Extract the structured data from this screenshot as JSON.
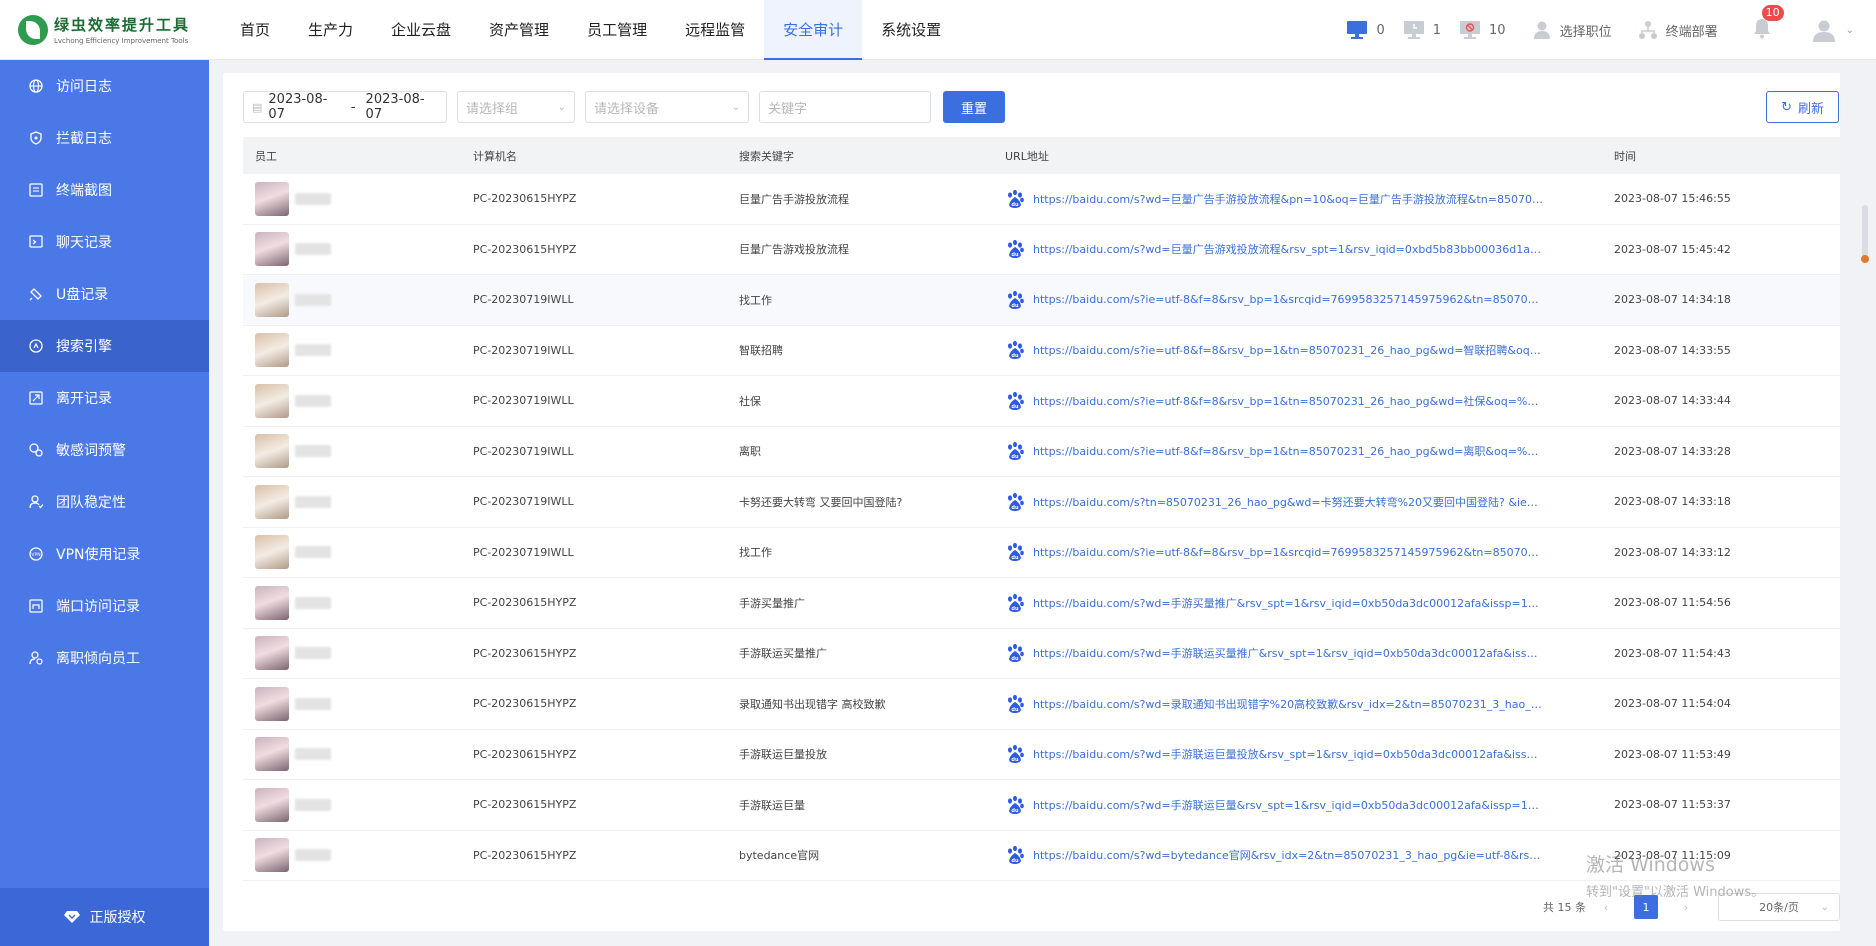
{
  "app": {
    "name": "绿虫效率提升工具",
    "subname": "Lvchong Efficiency Improvement Tools",
    "accent": "#3b6fe0",
    "sidebar_color": "#4a78e6"
  },
  "nav": [
    "首页",
    "生产力",
    "企业云盘",
    "资产管理",
    "员工管理",
    "远程监管",
    "安全审计",
    "系统设置"
  ],
  "status": {
    "online_count": "0",
    "idle_count": "1",
    "offline_count": "10",
    "select_position": "选择职位",
    "deploy_terminal": "终端部署",
    "notifications": "10"
  },
  "sidebar": {
    "items": [
      "访问日志",
      "拦截日志",
      "终端截图",
      "聊天记录",
      "U盘记录",
      "搜索引擎",
      "离开记录",
      "敏感词预警",
      "团队稳定性",
      "VPN使用记录",
      "端口访问记录",
      "离职倾向员工"
    ],
    "footer": "正版授权"
  },
  "filters": {
    "date_start": "2023-08-07",
    "date_sep": "-",
    "date_end": "2023-08-07",
    "group_placeholder": "请选择组",
    "device_placeholder": "请选择设备",
    "keyword_placeholder": "关键字",
    "reset": "重置",
    "refresh": "刷新"
  },
  "table": {
    "headers": [
      "员工",
      "计算机名",
      "搜索关键字",
      "URL地址",
      "时间"
    ],
    "rows": [
      {
        "pc": "PC-20230615HYPZ",
        "kw": "巨量广告手游投放流程",
        "url": "https://baidu.com/s?wd=巨量广告手游投放流程&pn=10&oq=巨量广告手游投放流程&tn=85070231...",
        "time": "2023-08-07 15:46:55",
        "av": "a"
      },
      {
        "pc": "PC-20230615HYPZ",
        "kw": "巨量广告游戏投放流程",
        "url": "https://baidu.com/s?wd=巨量广告游戏投放流程&rsv_spt=1&rsv_iqid=0xbd5b83bb00036d1a&issp...",
        "time": "2023-08-07 15:45:42",
        "av": "a"
      },
      {
        "pc": "PC-20230719IWLL",
        "kw": "找工作",
        "url": "https://baidu.com/s?ie=utf-8&f=8&rsv_bp=1&srcqid=7699583257145975962&tn=85070231_26_h...",
        "time": "2023-08-07 14:34:18",
        "av": "b"
      },
      {
        "pc": "PC-20230719IWLL",
        "kw": "智联招聘",
        "url": "https://baidu.com/s?ie=utf-8&f=8&rsv_bp=1&tn=85070231_26_hao_pg&wd=智联招聘&oq=%25E...",
        "time": "2023-08-07 14:33:55",
        "av": "b"
      },
      {
        "pc": "PC-20230719IWLL",
        "kw": "社保",
        "url": "https://baidu.com/s?ie=utf-8&f=8&rsv_bp=1&tn=85070231_26_hao_pg&wd=社保&oq=%25E7%2...",
        "time": "2023-08-07 14:33:44",
        "av": "b"
      },
      {
        "pc": "PC-20230719IWLL",
        "kw": "离职",
        "url": "https://baidu.com/s?ie=utf-8&f=8&rsv_bp=1&tn=85070231_26_hao_pg&wd=离职&oq=%25E5%2...",
        "time": "2023-08-07 14:33:28",
        "av": "b"
      },
      {
        "pc": "PC-20230719IWLL",
        "kw": "卡努还要大转弯 又要回中国登陆?",
        "url": "https://baidu.com/s?tn=85070231_26_hao_pg&wd=卡努还要大转弯%20又要回中国登陆? &ie=utf-...",
        "time": "2023-08-07 14:33:18",
        "av": "b"
      },
      {
        "pc": "PC-20230719IWLL",
        "kw": "找工作",
        "url": "https://baidu.com/s?ie=utf-8&f=8&rsv_bp=1&srcqid=7699583257145975962&tn=85070231_26_h...",
        "time": "2023-08-07 14:33:12",
        "av": "b"
      },
      {
        "pc": "PC-20230615HYPZ",
        "kw": "手游买量推广",
        "url": "https://baidu.com/s?wd=手游买量推广&rsv_spt=1&rsv_iqid=0xb50da3dc00012afa&issp=1&f=8&rs...",
        "time": "2023-08-07 11:54:56",
        "av": "a"
      },
      {
        "pc": "PC-20230615HYPZ",
        "kw": "手游联运买量推广",
        "url": "https://baidu.com/s?wd=手游联运买量推广&rsv_spt=1&rsv_iqid=0xb50da3dc00012afa&issp=1&f=...",
        "time": "2023-08-07 11:54:43",
        "av": "a"
      },
      {
        "pc": "PC-20230615HYPZ",
        "kw": "录取通知书出现错字 高校致歉",
        "url": "https://baidu.com/s?wd=录取通知书出现错字%20高校致歉&rsv_idx=2&tn=85070231_3_hao_pg&...",
        "time": "2023-08-07 11:54:04",
        "av": "a"
      },
      {
        "pc": "PC-20230615HYPZ",
        "kw": "手游联运巨量投放",
        "url": "https://baidu.com/s?wd=手游联运巨量投放&rsv_spt=1&rsv_iqid=0xb50da3dc00012afa&issp=1&f=...",
        "time": "2023-08-07 11:53:49",
        "av": "a"
      },
      {
        "pc": "PC-20230615HYPZ",
        "kw": "手游联运巨量",
        "url": "https://baidu.com/s?wd=手游联运巨量&rsv_spt=1&rsv_iqid=0xb50da3dc00012afa&issp=1&f=8&rs...",
        "time": "2023-08-07 11:53:37",
        "av": "a"
      },
      {
        "pc": "PC-20230615HYPZ",
        "kw": "bytedance官网",
        "url": "https://baidu.com/s?wd=bytedance官网&rsv_idx=2&tn=85070231_3_hao_pg&ie=utf-8&rsv_pq=a1...",
        "time": "2023-08-07 11:15:09",
        "av": "a"
      }
    ]
  },
  "pager": {
    "total": "共 15 条",
    "page": "1",
    "size": "20条/页"
  },
  "watermark": {
    "line1": "激活 Windows",
    "line2": "转到\"设置\"以激活 Windows。"
  }
}
